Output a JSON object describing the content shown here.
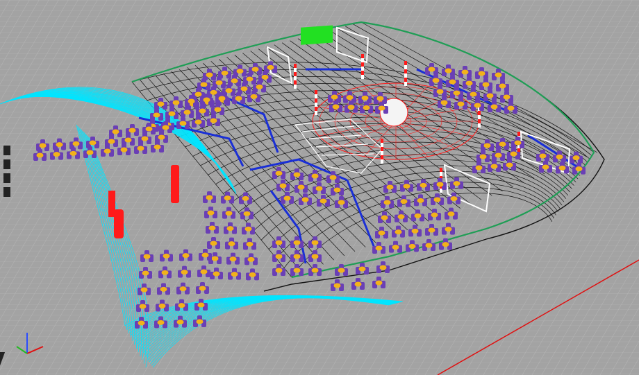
{
  "viewport": {
    "view_type": "perspective-wireframe",
    "background_color": "#a3a3a3",
    "grid_color": "#bdbdbd",
    "grid_major_color": "#8c8c8c"
  },
  "scene": {
    "colors": {
      "structure": "#111111",
      "canopy": "#00e5ff",
      "perimeter_rail": "#1f9e55",
      "seats": "#6a3fb5",
      "tables": "#f2b21a",
      "barriers": "#1a2fd6",
      "central_stage": "#ff1a1a",
      "screen": "#22e022",
      "walkway": "#ffffff",
      "columns": "#ff1a1a"
    },
    "icons": {
      "origin_marker": "red-axis-line-icon",
      "axis_gizmo": "xyz-axis-gizmo-icon"
    }
  }
}
